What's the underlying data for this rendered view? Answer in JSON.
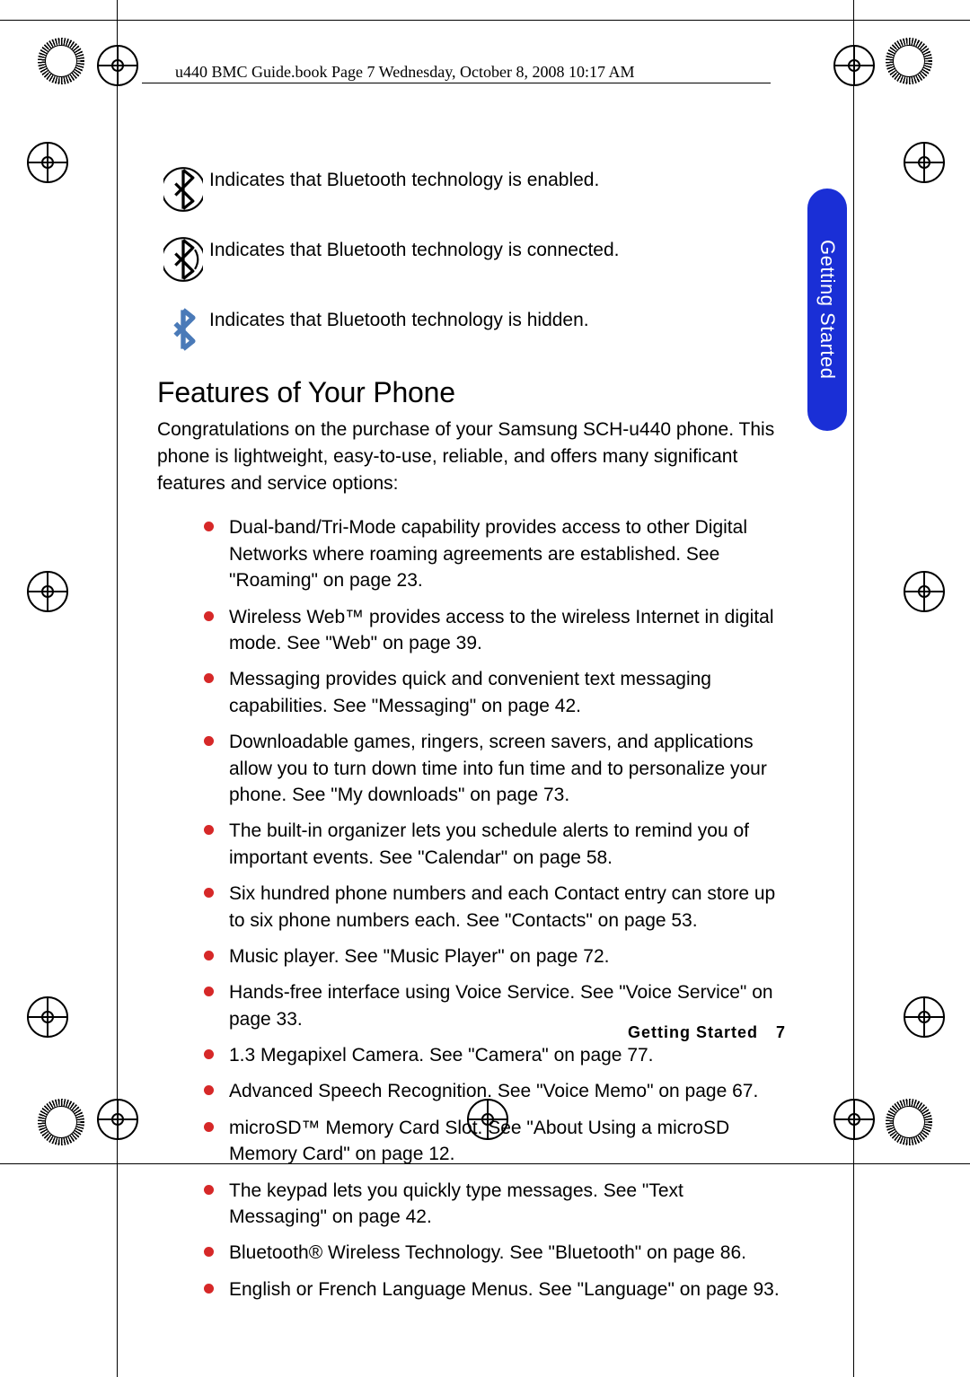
{
  "doc_path": "u440 BMC Guide.book  Page 7  Wednesday, October 8, 2008  10:17 AM",
  "icons": [
    {
      "name": "bluetooth-enabled-icon",
      "text": "Indicates that Bluetooth technology is enabled."
    },
    {
      "name": "bluetooth-connected-icon",
      "text": "Indicates that Bluetooth technology is connected."
    },
    {
      "name": "bluetooth-hidden-icon",
      "text": "Indicates that Bluetooth technology is hidden."
    }
  ],
  "section_title": "Features of Your Phone",
  "intro": "Congratulations on the purchase of your Samsung SCH-u440 phone. This phone is lightweight, easy-to-use, reliable, and offers many significant features and service options:",
  "features": [
    "Dual-band/Tri-Mode capability provides access to other Digital Networks where roaming agreements are established. See \"Roaming\" on page 23.",
    "Wireless Web™ provides access to the wireless Internet in digital mode. See \"Web\" on page 39.",
    "Messaging provides quick and convenient text messaging capabilities. See \"Messaging\" on page 42.",
    "Downloadable games, ringers, screen savers, and applications allow you to turn down time into fun time and to personalize your phone. See \"My downloads\" on page 73.",
    "The built-in organizer lets you schedule alerts to remind you of important events. See \"Calendar\" on page 58.",
    "Six hundred phone numbers and each Contact entry can store up to six phone numbers each. See \"Contacts\" on page 53.",
    "Music player. See \"Music Player\" on page 72.",
    "Hands-free interface using Voice Service. See \"Voice Service\" on page 33.",
    "1.3 Megapixel Camera. See \"Camera\" on page 77.",
    "Advanced Speech Recognition. See \"Voice Memo\" on page 67.",
    "microSD™ Memory Card Slot. See \"About Using a microSD Memory Card\" on page 12.",
    "The keypad lets you quickly type messages. See \"Text Messaging\" on page 42.",
    "Bluetooth® Wireless Technology. See \"Bluetooth\" on page 86.",
    "English or French Language Menus. See \"Language\" on page 93."
  ],
  "side_tab": "Getting Started",
  "footer_label": "Getting Started",
  "footer_page": "7"
}
